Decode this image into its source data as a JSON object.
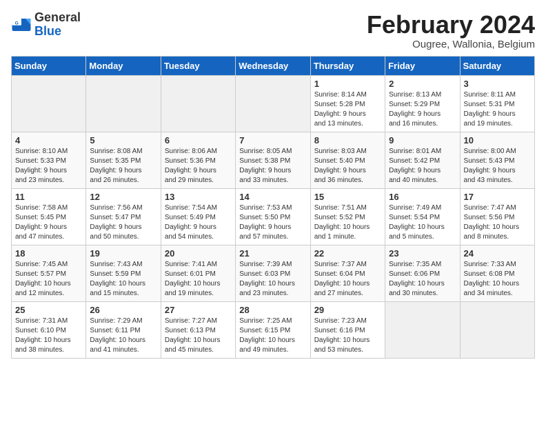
{
  "logo": {
    "general": "General",
    "blue": "Blue"
  },
  "title": "February 2024",
  "subtitle": "Ougree, Wallonia, Belgium",
  "days_header": [
    "Sunday",
    "Monday",
    "Tuesday",
    "Wednesday",
    "Thursday",
    "Friday",
    "Saturday"
  ],
  "weeks": [
    {
      "days": [
        {
          "num": "",
          "text": ""
        },
        {
          "num": "",
          "text": ""
        },
        {
          "num": "",
          "text": ""
        },
        {
          "num": "",
          "text": ""
        },
        {
          "num": "1",
          "text": "Sunrise: 8:14 AM\nSunset: 5:28 PM\nDaylight: 9 hours\nand 13 minutes."
        },
        {
          "num": "2",
          "text": "Sunrise: 8:13 AM\nSunset: 5:29 PM\nDaylight: 9 hours\nand 16 minutes."
        },
        {
          "num": "3",
          "text": "Sunrise: 8:11 AM\nSunset: 5:31 PM\nDaylight: 9 hours\nand 19 minutes."
        }
      ]
    },
    {
      "days": [
        {
          "num": "4",
          "text": "Sunrise: 8:10 AM\nSunset: 5:33 PM\nDaylight: 9 hours\nand 23 minutes."
        },
        {
          "num": "5",
          "text": "Sunrise: 8:08 AM\nSunset: 5:35 PM\nDaylight: 9 hours\nand 26 minutes."
        },
        {
          "num": "6",
          "text": "Sunrise: 8:06 AM\nSunset: 5:36 PM\nDaylight: 9 hours\nand 29 minutes."
        },
        {
          "num": "7",
          "text": "Sunrise: 8:05 AM\nSunset: 5:38 PM\nDaylight: 9 hours\nand 33 minutes."
        },
        {
          "num": "8",
          "text": "Sunrise: 8:03 AM\nSunset: 5:40 PM\nDaylight: 9 hours\nand 36 minutes."
        },
        {
          "num": "9",
          "text": "Sunrise: 8:01 AM\nSunset: 5:42 PM\nDaylight: 9 hours\nand 40 minutes."
        },
        {
          "num": "10",
          "text": "Sunrise: 8:00 AM\nSunset: 5:43 PM\nDaylight: 9 hours\nand 43 minutes."
        }
      ]
    },
    {
      "days": [
        {
          "num": "11",
          "text": "Sunrise: 7:58 AM\nSunset: 5:45 PM\nDaylight: 9 hours\nand 47 minutes."
        },
        {
          "num": "12",
          "text": "Sunrise: 7:56 AM\nSunset: 5:47 PM\nDaylight: 9 hours\nand 50 minutes."
        },
        {
          "num": "13",
          "text": "Sunrise: 7:54 AM\nSunset: 5:49 PM\nDaylight: 9 hours\nand 54 minutes."
        },
        {
          "num": "14",
          "text": "Sunrise: 7:53 AM\nSunset: 5:50 PM\nDaylight: 9 hours\nand 57 minutes."
        },
        {
          "num": "15",
          "text": "Sunrise: 7:51 AM\nSunset: 5:52 PM\nDaylight: 10 hours\nand 1 minute."
        },
        {
          "num": "16",
          "text": "Sunrise: 7:49 AM\nSunset: 5:54 PM\nDaylight: 10 hours\nand 5 minutes."
        },
        {
          "num": "17",
          "text": "Sunrise: 7:47 AM\nSunset: 5:56 PM\nDaylight: 10 hours\nand 8 minutes."
        }
      ]
    },
    {
      "days": [
        {
          "num": "18",
          "text": "Sunrise: 7:45 AM\nSunset: 5:57 PM\nDaylight: 10 hours\nand 12 minutes."
        },
        {
          "num": "19",
          "text": "Sunrise: 7:43 AM\nSunset: 5:59 PM\nDaylight: 10 hours\nand 15 minutes."
        },
        {
          "num": "20",
          "text": "Sunrise: 7:41 AM\nSunset: 6:01 PM\nDaylight: 10 hours\nand 19 minutes."
        },
        {
          "num": "21",
          "text": "Sunrise: 7:39 AM\nSunset: 6:03 PM\nDaylight: 10 hours\nand 23 minutes."
        },
        {
          "num": "22",
          "text": "Sunrise: 7:37 AM\nSunset: 6:04 PM\nDaylight: 10 hours\nand 27 minutes."
        },
        {
          "num": "23",
          "text": "Sunrise: 7:35 AM\nSunset: 6:06 PM\nDaylight: 10 hours\nand 30 minutes."
        },
        {
          "num": "24",
          "text": "Sunrise: 7:33 AM\nSunset: 6:08 PM\nDaylight: 10 hours\nand 34 minutes."
        }
      ]
    },
    {
      "days": [
        {
          "num": "25",
          "text": "Sunrise: 7:31 AM\nSunset: 6:10 PM\nDaylight: 10 hours\nand 38 minutes."
        },
        {
          "num": "26",
          "text": "Sunrise: 7:29 AM\nSunset: 6:11 PM\nDaylight: 10 hours\nand 41 minutes."
        },
        {
          "num": "27",
          "text": "Sunrise: 7:27 AM\nSunset: 6:13 PM\nDaylight: 10 hours\nand 45 minutes."
        },
        {
          "num": "28",
          "text": "Sunrise: 7:25 AM\nSunset: 6:15 PM\nDaylight: 10 hours\nand 49 minutes."
        },
        {
          "num": "29",
          "text": "Sunrise: 7:23 AM\nSunset: 6:16 PM\nDaylight: 10 hours\nand 53 minutes."
        },
        {
          "num": "",
          "text": ""
        },
        {
          "num": "",
          "text": ""
        }
      ]
    }
  ]
}
